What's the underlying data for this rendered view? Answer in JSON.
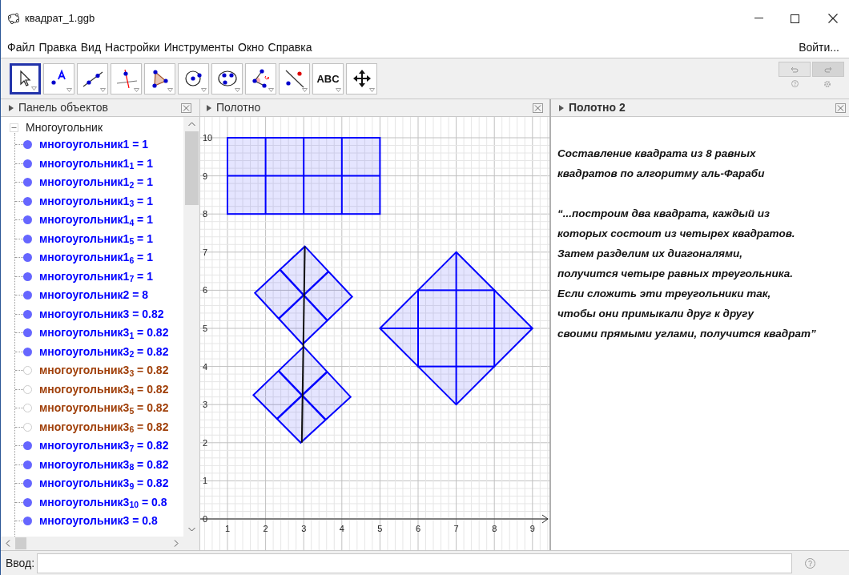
{
  "window": {
    "title": "квадрат_1.ggb"
  },
  "menu": [
    "Файл",
    "Правка",
    "Вид",
    "Настройки",
    "Инструменты",
    "Окно",
    "Справка"
  ],
  "sign_in": "Войти...",
  "tools": [
    {
      "kind": "pointer",
      "selected": true
    },
    {
      "kind": "point",
      "selected": false
    },
    {
      "kind": "line",
      "selected": false
    },
    {
      "kind": "perpendicular",
      "selected": false
    },
    {
      "kind": "polygon",
      "selected": false
    },
    {
      "kind": "circle",
      "selected": false
    },
    {
      "kind": "conic",
      "selected": false
    },
    {
      "kind": "angle",
      "selected": false
    },
    {
      "kind": "reflect",
      "selected": false
    },
    {
      "kind": "text",
      "label": "ABC",
      "selected": false
    },
    {
      "kind": "move",
      "selected": false
    }
  ],
  "algebra": {
    "title": "Панель объектов",
    "group": {
      "label": "Многоугольник",
      "expanded": true
    },
    "items": [
      {
        "text": "многоугольник1 = 1",
        "visible": true,
        "color": "#0000ff"
      },
      {
        "text": "многоугольник1$_{1}$ = 1",
        "visible": true,
        "color": "#0000ff"
      },
      {
        "text": "многоугольник1$_{2}$ = 1",
        "visible": true,
        "color": "#0000ff"
      },
      {
        "text": "многоугольник1$_{3}$ = 1",
        "visible": true,
        "color": "#0000ff"
      },
      {
        "text": "многоугольник1$_{4}$ = 1",
        "visible": true,
        "color": "#0000ff"
      },
      {
        "text": "многоугольник1$_{5}$ = 1",
        "visible": true,
        "color": "#0000ff"
      },
      {
        "text": "многоугольник1$_{6}$ = 1",
        "visible": true,
        "color": "#0000ff"
      },
      {
        "text": "многоугольник1$_{7}$ = 1",
        "visible": true,
        "color": "#0000ff"
      },
      {
        "text": "многоугольник2 = 8",
        "visible": true,
        "color": "#0000ff"
      },
      {
        "text": "многоугольник3 = 0.82",
        "visible": true,
        "color": "#0000ff"
      },
      {
        "text": "многоугольник3$_{1}$ = 0.82",
        "visible": true,
        "color": "#0000ff"
      },
      {
        "text": "многоугольник3$_{2}$ = 0.82",
        "visible": true,
        "color": "#0000ff"
      },
      {
        "text": "многоугольник3$_{3}$ = 0.82",
        "visible": false,
        "color": "#a0400a"
      },
      {
        "text": "многоугольник3$_{4}$ = 0.82",
        "visible": false,
        "color": "#a0400a"
      },
      {
        "text": "многоугольник3$_{5}$ = 0.82",
        "visible": false,
        "color": "#a0400a"
      },
      {
        "text": "многоугольник3$_{6}$ = 0.82",
        "visible": false,
        "color": "#a0400a"
      },
      {
        "text": "многоугольник3$_{7}$ = 0.82",
        "visible": true,
        "color": "#0000ff"
      },
      {
        "text": "многоугольник3$_{8}$ = 0.82",
        "visible": true,
        "color": "#0000ff"
      },
      {
        "text": "многоугольник3$_{9}$ = 0.82",
        "visible": true,
        "color": "#0000ff"
      },
      {
        "text": "многоугольник3$_{10}$ = 0.8",
        "visible": true,
        "color": "#0000ff"
      },
      {
        "text": "многоугольник3 = 0.8",
        "visible": true,
        "color": "#0000ff"
      }
    ]
  },
  "graphics": {
    "title": "Полотно",
    "x_labels": [
      "1",
      "2",
      "3",
      "4",
      "5",
      "6",
      "7",
      "8",
      "9"
    ],
    "y_labels": [
      "10",
      "9",
      "8",
      "7",
      "6",
      "5",
      "4",
      "3",
      "2",
      "1",
      "0"
    ]
  },
  "graphics2": {
    "title": "Полотно 2",
    "paragraphs": [
      "Составление квадрата из 8 равных\nквадратов по алгоритму аль-Фараби",
      "“...построим два квадрата, каждый из\nкоторых состоит из четырех квадратов.\nЗатем разделим их диагоналями,\nполучится четыре равных треугольника.\nЕсли сложить эти треугольники так,\nчтобы они примыкали друг к другу\nсвоими прямыми углами, получится квадрат”"
    ]
  },
  "input_bar": {
    "label": "Ввод:"
  }
}
